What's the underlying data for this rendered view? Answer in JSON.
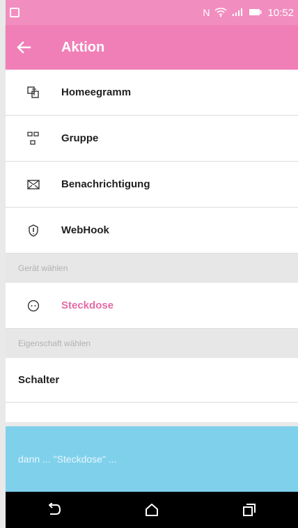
{
  "status_bar": {
    "time": "10:52",
    "left_icon": "device-icon",
    "nfc_icon": "nfc-icon",
    "wifi_icon": "wifi-icon",
    "signal_icon": "signal-icon",
    "battery_icon": "battery-icon",
    "color": "#f18ebf"
  },
  "app_bar": {
    "title": "Aktion",
    "back_icon": "back-arrow-icon",
    "color": "#f17fb7"
  },
  "actions": [
    {
      "label": "Homeegramm",
      "icon": "homeegram-icon"
    },
    {
      "label": "Gruppe",
      "icon": "group-icon"
    },
    {
      "label": "Benachrichtigung",
      "icon": "envelope-icon"
    },
    {
      "label": "WebHook",
      "icon": "webhook-icon"
    }
  ],
  "sections": {
    "device_header": "Gerät wählen",
    "property_header": "Eigenschaft wählen"
  },
  "selected_device": {
    "label": "Steckdose",
    "icon": "socket-icon",
    "color": "#e46aa5"
  },
  "selected_property": {
    "label": "Schalter"
  },
  "summary": {
    "text": "dann ... \"Steckdose\" ...",
    "color": "#7fd0eb"
  },
  "navigation": {
    "back_icon": "nav-back-icon",
    "home_icon": "home-icon",
    "recent_icon": "recent-apps-icon"
  }
}
